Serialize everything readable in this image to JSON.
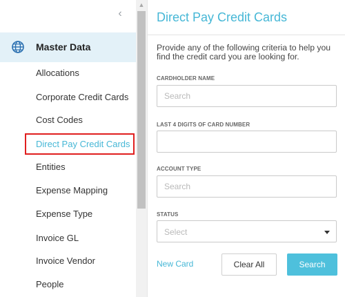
{
  "sidebar": {
    "collapse_icon": "chevron-left-icon",
    "collapse_glyph": "‹",
    "section": {
      "label": "Master Data",
      "icon": "globe-icon"
    },
    "items": [
      {
        "label": "Allocations"
      },
      {
        "label": "Corporate Credit Cards"
      },
      {
        "label": "Cost Codes"
      },
      {
        "label": "Direct Pay Credit Cards",
        "active": true
      },
      {
        "label": "Entities"
      },
      {
        "label": "Expense Mapping"
      },
      {
        "label": "Expense Type"
      },
      {
        "label": "Invoice GL"
      },
      {
        "label": "Invoice Vendor"
      },
      {
        "label": "People"
      }
    ]
  },
  "main": {
    "title": "Direct Pay Credit Cards",
    "description": "Provide any of the following criteria to help you find the credit card you are looking for.",
    "fields": {
      "cardholder": {
        "label": "CARDHOLDER NAME",
        "placeholder": "Search",
        "value": ""
      },
      "last4": {
        "label": "LAST 4 DIGITS OF CARD NUMBER",
        "placeholder": "",
        "value": ""
      },
      "account_type": {
        "label": "ACCOUNT TYPE",
        "placeholder": "Search",
        "value": ""
      },
      "status": {
        "label": "STATUS",
        "selected": "Select"
      }
    },
    "actions": {
      "new_card": "New Card",
      "clear_all": "Clear All",
      "search": "Search"
    }
  },
  "colors": {
    "accent": "#46b7d6",
    "search_button": "#4ec0dc",
    "section_bg": "#e3f1f8",
    "highlight_border": "#e01e1e"
  }
}
